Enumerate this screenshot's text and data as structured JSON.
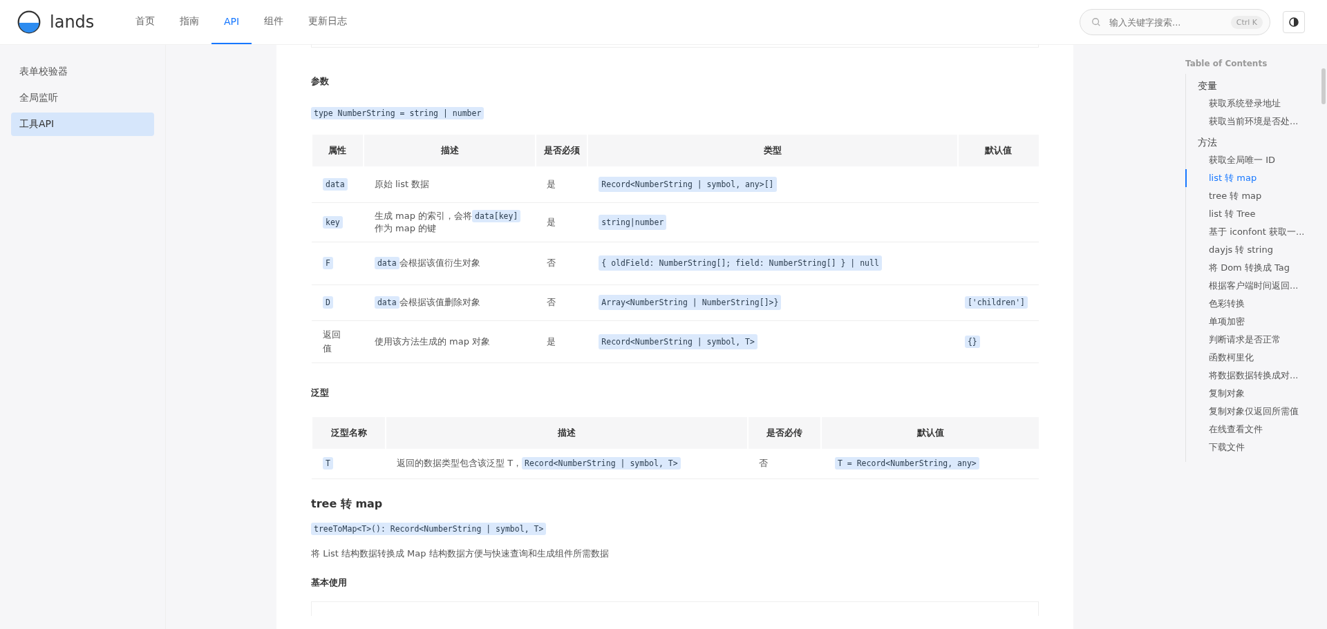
{
  "header": {
    "logo": "lands",
    "nav": [
      {
        "label": "首页",
        "selected": false
      },
      {
        "label": "指南",
        "selected": false
      },
      {
        "label": "API",
        "selected": true
      },
      {
        "label": "组件",
        "selected": false
      },
      {
        "label": "更新日志",
        "selected": false
      }
    ],
    "search": {
      "placeholder": "输入关键字搜索...",
      "shortcut": "Ctrl K"
    }
  },
  "sidebar": {
    "items": [
      {
        "label": "表单校验器",
        "selected": false
      },
      {
        "label": "全局监听",
        "selected": false
      },
      {
        "label": "工具API",
        "selected": true
      }
    ]
  },
  "content": {
    "params_heading": "参数",
    "type_code": "type NumberString = string | number",
    "params_table": {
      "columns": [
        "属性",
        "描述",
        "是否必须",
        "类型",
        "默认值"
      ],
      "rows": [
        {
          "name": "data",
          "kind": "code",
          "desc": [
            {
              "kind": "text",
              "text": "原始 list 数据"
            }
          ],
          "required": "是",
          "type": "Record<NumberString | symbol, any>[]",
          "default": ""
        },
        {
          "name": "key",
          "kind": "code",
          "desc": [
            {
              "kind": "text",
              "text": "生成 map 的索引，会将"
            },
            {
              "kind": "code",
              "text": "data[key]"
            },
            {
              "kind": "text",
              "text": "作为 map 的键"
            }
          ],
          "required": "是",
          "type": "string|number",
          "default": ""
        },
        {
          "name": "F",
          "kind": "code",
          "desc": [
            {
              "kind": "code",
              "text": "data"
            },
            {
              "kind": "text",
              "text": "会根据该值衍生对象"
            }
          ],
          "required": "否",
          "type": "{ oldField: NumberString[]; field: NumberString[] } | null",
          "default": ""
        },
        {
          "name": "D",
          "kind": "code",
          "desc": [
            {
              "kind": "code",
              "text": "data"
            },
            {
              "kind": "text",
              "text": "会根据该值删除对象"
            }
          ],
          "required": "否",
          "type": "Array<NumberString | NumberString[]>}",
          "default": "['children']"
        },
        {
          "name": "返回值",
          "kind": "text",
          "desc": [
            {
              "kind": "text",
              "text": "使用该方法生成的 map 对象"
            }
          ],
          "required": "是",
          "type": "Record<NumberString | symbol, T>",
          "default": "{}"
        }
      ]
    },
    "generics_heading": "泛型",
    "generics_table": {
      "columns": [
        "泛型名称",
        "描述",
        "是否必传",
        "默认值"
      ],
      "rows": [
        {
          "name": "T",
          "desc": [
            {
              "kind": "text",
              "text": "返回的数据类型包含该泛型 T，"
            },
            {
              "kind": "code",
              "text": "Record<NumberString | symbol, T>"
            }
          ],
          "required": "否",
          "default": "T = Record<NumberString, any>"
        }
      ]
    },
    "section_title": "tree 转 map",
    "signature": "treeToMap<T>(): Record<NumberString | symbol, T>",
    "description": "将 List 结构数据转换成 Map 结构数据方便与快速查询和生成组件所需数据",
    "usage_heading": "基本使用"
  },
  "toc": {
    "title": "Table of Contents",
    "groups": [
      {
        "label": "变量",
        "children": [
          {
            "label": "获取系统登录地址",
            "selected": false
          },
          {
            "label": "获取当前环境是否处...",
            "selected": false
          }
        ]
      },
      {
        "label": "方法",
        "children": [
          {
            "label": "获取全局唯一 ID",
            "selected": false
          },
          {
            "label": "list 转 map",
            "selected": true
          },
          {
            "label": "tree 转 map",
            "selected": false
          },
          {
            "label": "list 转 Tree",
            "selected": false
          },
          {
            "label": "基于 iconfont 获取一...",
            "selected": false
          },
          {
            "label": "dayjs 转 string",
            "selected": false
          },
          {
            "label": "将 Dom 转换成 Tag",
            "selected": false
          },
          {
            "label": "根据客户端时间返回...",
            "selected": false
          },
          {
            "label": "色彩转换",
            "selected": false
          },
          {
            "label": "单项加密",
            "selected": false
          },
          {
            "label": "判断请求是否正常",
            "selected": false
          },
          {
            "label": "函数柯里化",
            "selected": false
          },
          {
            "label": "将数据数据转换成对...",
            "selected": false
          },
          {
            "label": "复制对象",
            "selected": false
          },
          {
            "label": "复制对象仅返回所需值",
            "selected": false
          },
          {
            "label": "在线查看文件",
            "selected": false
          },
          {
            "label": "下载文件",
            "selected": false
          }
        ]
      }
    ]
  }
}
